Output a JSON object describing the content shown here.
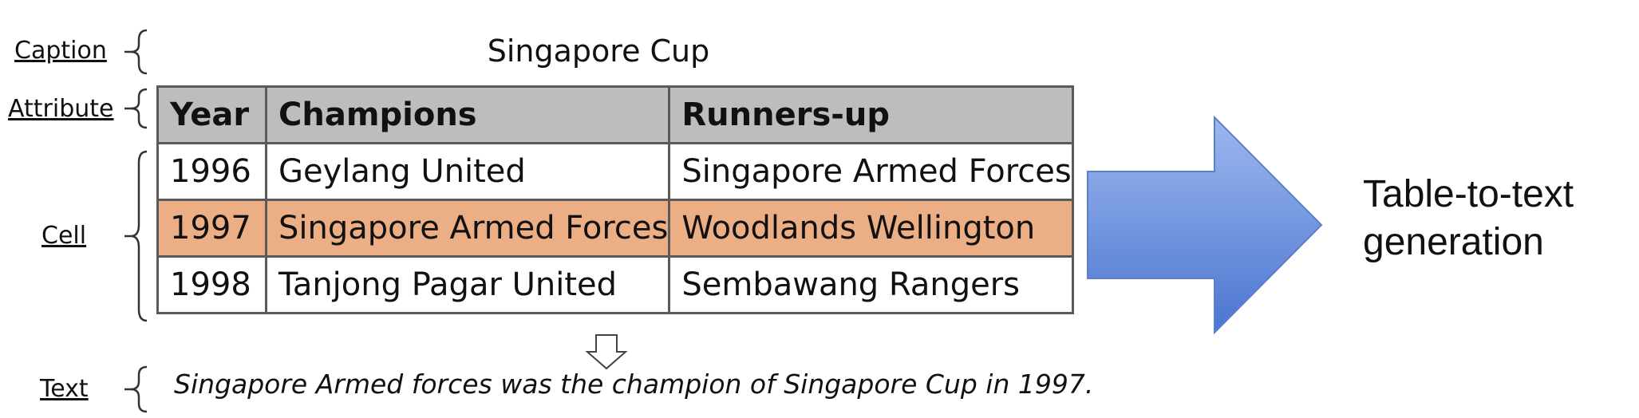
{
  "labels": {
    "caption": "Caption",
    "attribute": "Attribute",
    "cell": "Cell",
    "text": "Text"
  },
  "caption": "Singapore Cup",
  "table": {
    "headers": [
      "Year",
      "Champions",
      "Runners-up"
    ],
    "rows": [
      [
        "1996",
        "Geylang United",
        "Singapore Armed Forces"
      ],
      [
        "1997",
        "Singapore Armed Forces",
        "Woodlands Wellington"
      ],
      [
        "1998",
        "Tanjong Pagar United",
        "Sembawang Rangers"
      ]
    ],
    "highlighted_row_index": 1,
    "highlight_color": "#ecae84",
    "header_color": "#bdbdbd"
  },
  "text_sentence": "Singapore Armed forces was the champion of Singapore Cup in 1997.",
  "result_label": {
    "line1": "Table-to-text",
    "line2": "generation"
  },
  "arrow_colors": {
    "top": "#9db8ef",
    "bottom": "#4b75cf",
    "stroke": "#5b7fc8"
  }
}
